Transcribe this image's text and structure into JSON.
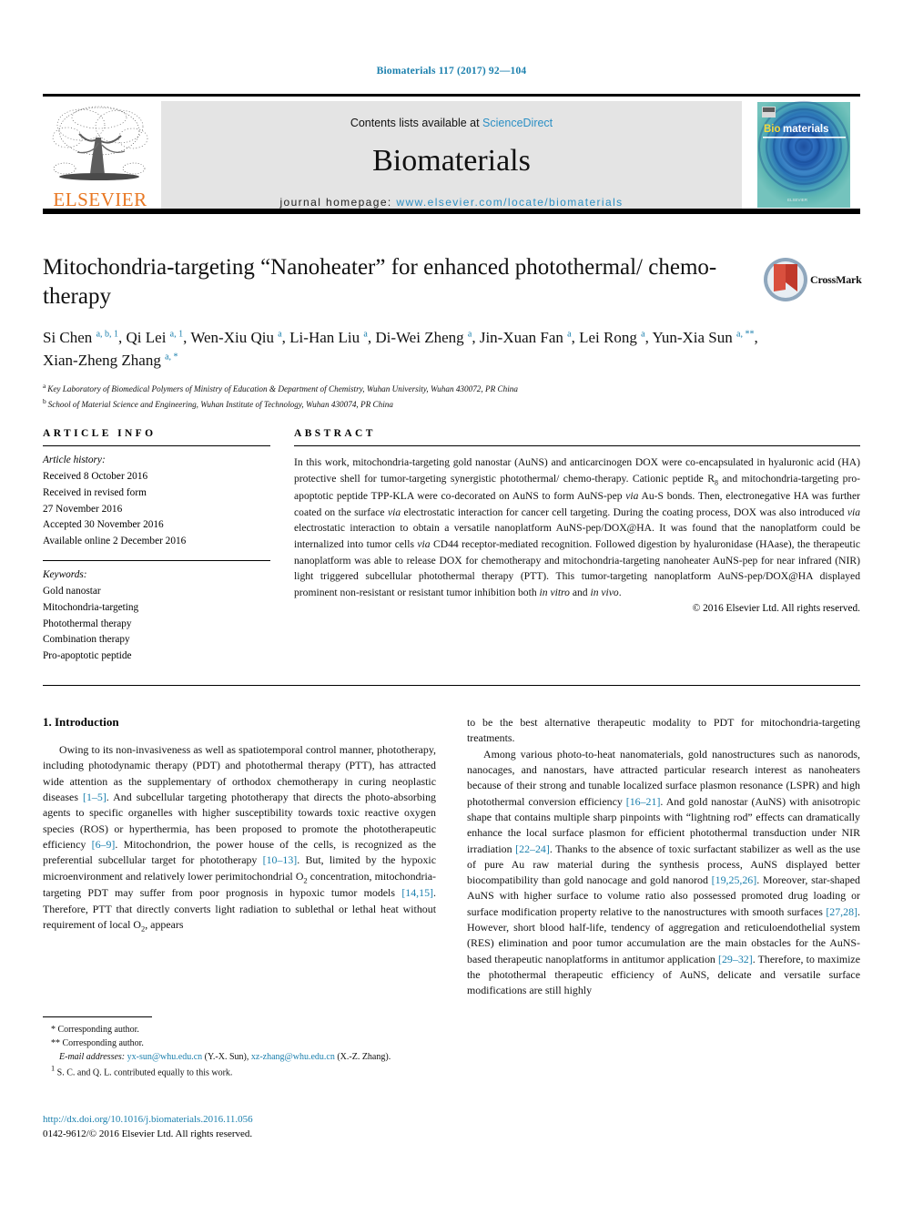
{
  "running_head": "Biomaterials 117 (2017) 92—104",
  "masthead": {
    "contents_prefix": "Contents lists available at ",
    "sciencedirect": "ScienceDirect",
    "journal_name": "Biomaterials",
    "homepage_prefix": "journal homepage: ",
    "homepage_url": "www.elsevier.com/locate/biomaterials",
    "publisher": "ELSEVIER",
    "cover_title_highlight": "Bio",
    "cover_title_rest": "materials"
  },
  "crossmark": {
    "label": "CrossMark"
  },
  "article": {
    "title": "Mitochondria-targeting “Nanoheater” for enhanced photothermal/ chemo-therapy",
    "authors": [
      {
        "name": "Si Chen",
        "marks": "a, b, 1"
      },
      {
        "name": "Qi Lei",
        "marks": "a, 1"
      },
      {
        "name": "Wen-Xiu Qiu",
        "marks": "a"
      },
      {
        "name": "Li-Han Liu",
        "marks": "a"
      },
      {
        "name": "Di-Wei Zheng",
        "marks": "a"
      },
      {
        "name": "Jin-Xuan Fan",
        "marks": "a"
      },
      {
        "name": "Lei Rong",
        "marks": "a"
      },
      {
        "name": "Yun-Xia Sun",
        "marks": "a, **"
      },
      {
        "name": "Xian-Zheng Zhang",
        "marks": "a, *"
      }
    ],
    "affiliations": [
      {
        "mark": "a",
        "text": "Key Laboratory of Biomedical Polymers of Ministry of Education & Department of Chemistry, Wuhan University, Wuhan 430072, PR China"
      },
      {
        "mark": "b",
        "text": "School of Material Science and Engineering, Wuhan Institute of Technology, Wuhan 430074, PR China"
      }
    ]
  },
  "article_info": {
    "heading": "ARTICLE INFO",
    "history_label": "Article history:",
    "history": [
      "Received 8 October 2016",
      "Received in revised form",
      "27 November 2016",
      "Accepted 30 November 2016",
      "Available online 2 December 2016"
    ],
    "keywords_label": "Keywords:",
    "keywords": [
      "Gold nanostar",
      "Mitochondria-targeting",
      "Photothermal therapy",
      "Combination therapy",
      "Pro-apoptotic peptide"
    ]
  },
  "abstract": {
    "heading": "ABSTRACT",
    "text": "In this work, mitochondria-targeting gold nanostar (AuNS) and anticarcinogen DOX were co-encapsulated in hyaluronic acid (HA) protective shell for tumor-targeting synergistic photothermal/ chemo-therapy. Cationic peptide R8 and mitochondria-targeting pro-apoptotic peptide TPP-KLA were co-decorated on AuNS to form AuNS-pep via Au-S bonds. Then, electronegative HA was further coated on the surface via electrostatic interaction for cancer cell targeting. During the coating process, DOX was also introduced via electrostatic interaction to obtain a versatile nanoplatform AuNS-pep/DOX@HA. It was found that the nanoplatform could be internalized into tumor cells via CD44 receptor-mediated recognition. Followed digestion by hyaluronidase (HAase), the therapeutic nanoplatform was able to release DOX for chemotherapy and mitochondria-targeting nanoheater AuNS-pep for near infrared (NIR) light triggered subcellular photothermal therapy (PTT). This tumor-targeting nanoplatform AuNS-pep/DOX@HA displayed prominent non-resistant or resistant tumor inhibition both in vitro and in vivo.",
    "copyright": "© 2016 Elsevier Ltd. All rights reserved."
  },
  "body": {
    "section_title": "1. Introduction",
    "left_paragraph": "Owing to its non-invasiveness as well as spatiotemporal control manner, phototherapy, including photodynamic therapy (PDT) and photothermal therapy (PTT), has attracted wide attention as the supplementary of orthodox chemotherapy in curing neoplastic diseases [1–5]. And subcellular targeting phototherapy that directs the photo-absorbing agents to specific organelles with higher susceptibility towards toxic reactive oxygen species (ROS) or hyperthermia, has been proposed to promote the phototherapeutic efficiency [6–9]. Mitochondrion, the power house of the cells, is recognized as the preferential subcellular target for phototherapy [10–13]. But, limited by the hypoxic microenvironment and relatively lower perimitochondrial O2 concentration, mitochondria-targeting PDT may suffer from poor prognosis in hypoxic tumor models [14,15]. Therefore, PTT that directly converts light radiation to sublethal or lethal heat without requirement of local O2, appears",
    "right_paragraph_1": "to be the best alternative therapeutic modality to PDT for mitochondria-targeting treatments.",
    "right_paragraph_2": "Among various photo-to-heat nanomaterials, gold nanostructures such as nanorods, nanocages, and nanostars, have attracted particular research interest as nanoheaters because of their strong and tunable localized surface plasmon resonance (LSPR) and high photothermal conversion efficiency [16–21]. And gold nanostar (AuNS) with anisotropic shape that contains multiple sharp pinpoints with “lightning rod” effects can dramatically enhance the local surface plasmon for efficient photothermal transduction under NIR irradiation [22–24]. Thanks to the absence of toxic surfactant stabilizer as well as the use of pure Au raw material during the synthesis process, AuNS displayed better biocompatibility than gold nanocage and gold nanorod [19,25,26]. Moreover, star-shaped AuNS with higher surface to volume ratio also possessed promoted drug loading or surface modification property relative to the nanostructures with smooth surfaces [27,28]. However, short blood half-life, tendency of aggregation and reticuloendothelial system (RES) elimination and poor tumor accumulation are the main obstacles for the AuNS-based therapeutic nanoplatforms in antitumor application [29–32]. Therefore, to maximize the photothermal therapeutic efficiency of AuNS, delicate and versatile surface modifications are still highly"
  },
  "footnotes": {
    "corresponding_1": "Corresponding author.",
    "corresponding_2": "Corresponding author.",
    "email_label": "E-mail addresses:",
    "email_1": "yx-sun@whu.edu.cn",
    "email_1_owner": "(Y.-X. Sun),",
    "email_2": "xz-zhang@whu.edu.cn",
    "email_2_owner": "(X.-Z. Zhang).",
    "equal_contribution": "S. C. and Q. L. contributed equally to this work."
  },
  "doi": {
    "url": "http://dx.doi.org/10.1016/j.biomaterials.2016.11.056",
    "issn_line": "0142-9612/© 2016 Elsevier Ltd. All rights reserved."
  },
  "colors": {
    "link_blue": "#1a7fad",
    "sciencedirect_blue": "#2b8fc4",
    "elsevier_orange": "#E87722",
    "banner_grey": "#e4e4e4"
  }
}
